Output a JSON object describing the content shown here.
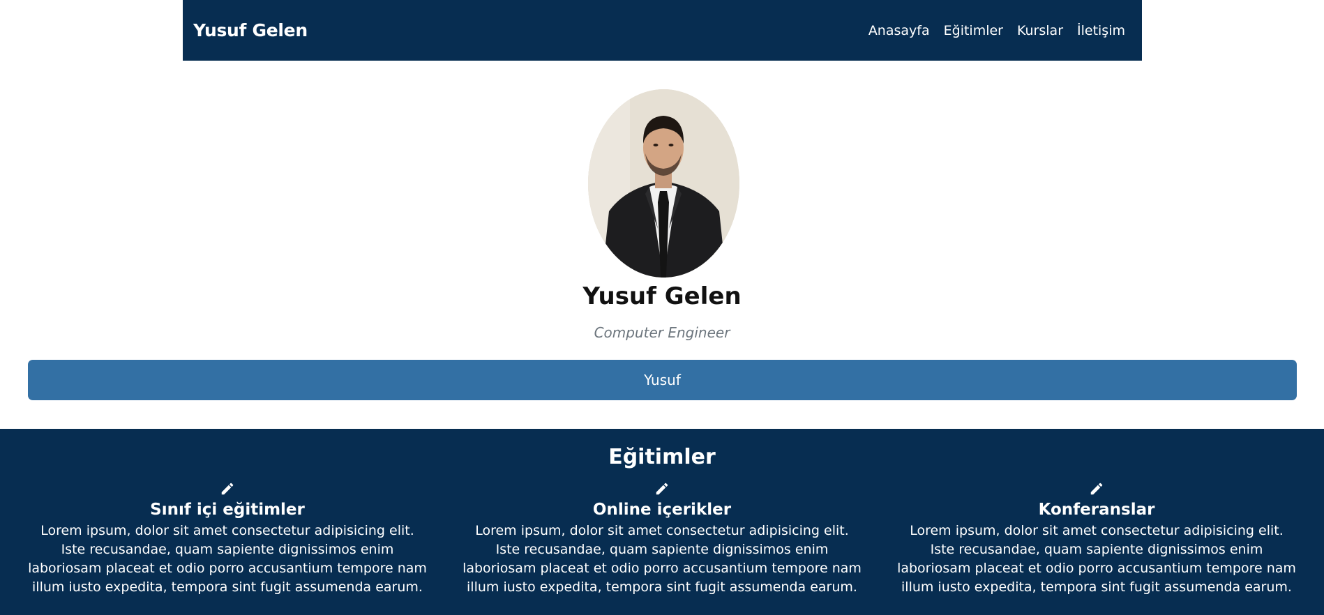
{
  "navbar": {
    "brand": "Yusuf Gelen",
    "links": [
      "Anasayfa",
      "Eğitimler",
      "Kurslar",
      "İletişim"
    ]
  },
  "hero": {
    "name": "Yusuf Gelen",
    "title": "Computer Engineer",
    "button_label": "Yusuf"
  },
  "services": {
    "title": "Eğitimler",
    "items": [
      {
        "icon": "pencil-icon",
        "title": "Sınıf içi eğitimler",
        "text": "Lorem ipsum, dolor sit amet consectetur adipisicing elit. Iste recusandae, quam sapiente dignissimos enim laboriosam placeat et odio porro accusantium tempore nam illum iusto expedita, tempora sint fugit assumenda earum."
      },
      {
        "icon": "pencil-icon",
        "title": "Online içerikler",
        "text": "Lorem ipsum, dolor sit amet consectetur adipisicing elit. Iste recusandae, quam sapiente dignissimos enim laboriosam placeat et odio porro accusantium tempore nam illum iusto expedita, tempora sint fugit assumenda earum."
      },
      {
        "icon": "pencil-icon",
        "title": "Konferanslar",
        "text": "Lorem ipsum, dolor sit amet consectetur adipisicing elit. Iste recusandae, quam sapiente dignissimos enim laboriosam placeat et odio porro accusantium tempore nam illum iusto expedita, tempora sint fugit assumenda earum."
      }
    ]
  },
  "colors": {
    "navy": "#072d51",
    "button_blue": "#3370a4",
    "muted_text": "#6c757d"
  }
}
